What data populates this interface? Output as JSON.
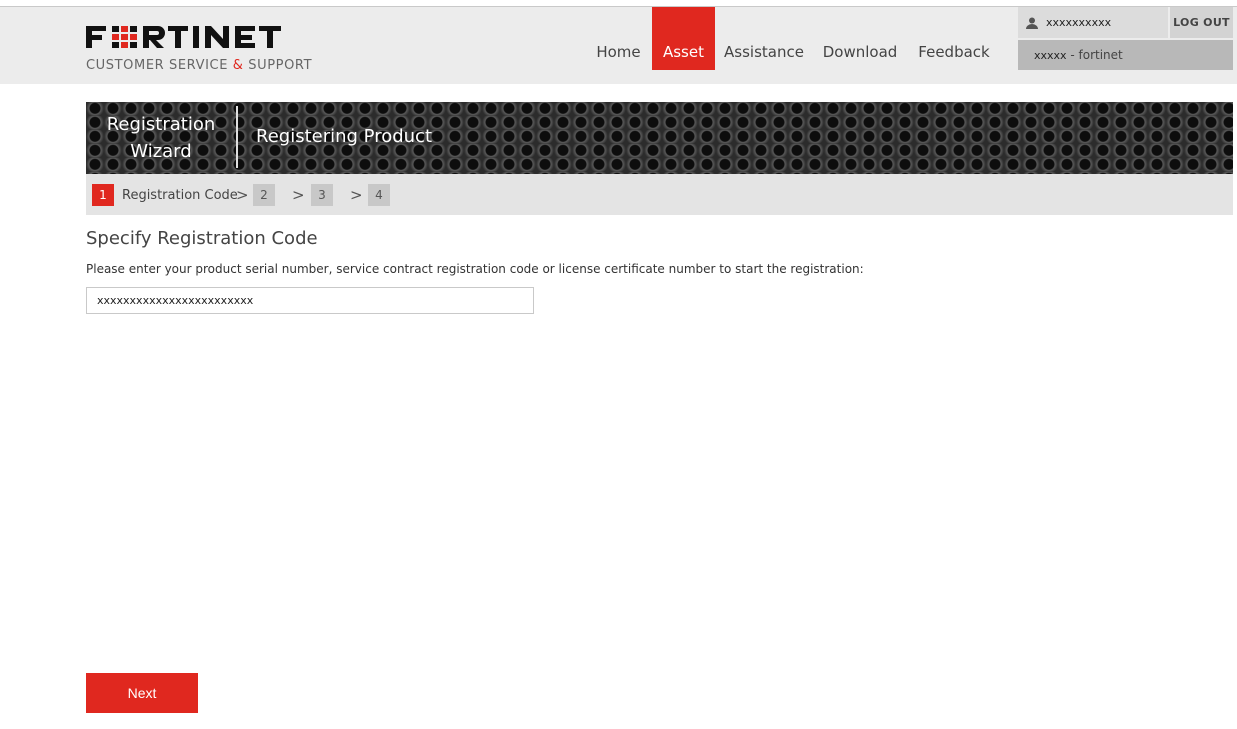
{
  "brand": {
    "name": "FORTINET",
    "subtitle_pre": "CUSTOMER SERVICE ",
    "subtitle_amp": "&",
    "subtitle_post": " SUPPORT",
    "accent": "#e0281f"
  },
  "nav": {
    "items": [
      {
        "label": "Home",
        "active": false
      },
      {
        "label": "Asset",
        "active": true
      },
      {
        "label": "Assistance",
        "active": false
      },
      {
        "label": "Download",
        "active": false
      },
      {
        "label": "Feedback",
        "active": false
      }
    ]
  },
  "user": {
    "name": "xxxxxxxxxx",
    "logout_label": "LOG OUT",
    "account_id": "xxxxx",
    "account_org": " - fortinet"
  },
  "banner": {
    "title": "Registration Wizard",
    "subtitle": "Registering Product"
  },
  "steps": {
    "items": [
      {
        "num": "1",
        "label": "Registration Code",
        "active": true
      },
      {
        "num": "2",
        "label": "",
        "active": false
      },
      {
        "num": "3",
        "label": "",
        "active": false
      },
      {
        "num": "4",
        "label": "",
        "active": false
      }
    ],
    "separator": ">"
  },
  "form": {
    "title": "Specify Registration Code",
    "instruction": "Please enter your product serial number, service contract registration code or license certificate number to start the registration:",
    "reg_code_value": "xxxxxxxxxxxxxxxxxxxxxxxx",
    "next_label": "Next"
  }
}
